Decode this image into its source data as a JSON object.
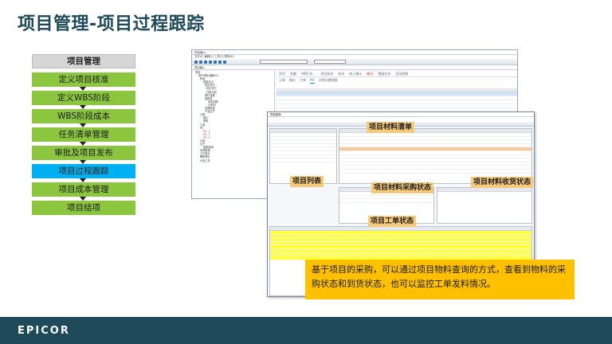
{
  "slide": {
    "title": "项目管理-项目过程跟踪"
  },
  "flow": {
    "header": "项目管理",
    "steps": [
      {
        "label": "定义项目核准",
        "active": false
      },
      {
        "label": "定义WBS阶段",
        "active": false
      },
      {
        "label": "WBS阶段成本",
        "active": false
      },
      {
        "label": "任务清单管理",
        "active": false
      },
      {
        "label": "审批及项目发布",
        "active": false
      },
      {
        "label": "项目过程跟踪",
        "active": true
      },
      {
        "label": "项目成本管理",
        "active": false
      },
      {
        "label": "项目结项",
        "active": false
      }
    ]
  },
  "app": {
    "window_title": "项目输入",
    "menu": "文件(F)  编辑(E)  工具(T)  帮助(H)",
    "nav_bar": "项目输入",
    "tabs": [
      "项目",
      "金额",
      "WBS 阶...",
      "项目成本",
      "成本",
      "收入确认",
      "概况",
      "遗留任务",
      "活动控制"
    ],
    "subtabs": [
      "订单",
      "报价",
      "工单",
      "PO",
      "计划分期明细"
    ],
    "tree": [
      "项目",
      "资产储存设备001",
      "阶段",
      "现金支出",
      "初步支付",
      "初步支付",
      "付款计划",
      "预付金额",
      "装修及",
      "未收到购",
      "已收到",
      "初期资金",
      "产品生产",
      "订单",
      "报价",
      "采购",
      "工单",
      "PO",
      "PO, 1",
      "PO, 1",
      "PO, 1",
      "计划",
      "生产",
      "差旅费用",
      "合同数量",
      "工作量计",
      "概率预计",
      "计划工作"
    ]
  },
  "query": {
    "window_title": "项目查询",
    "labels": {
      "material_list": "项目材料清单",
      "project_list": "项目列表",
      "purchase_status": "项目材料采购状态",
      "receipt_status": "项目材料收货状态",
      "job_status": "项目工单状态"
    }
  },
  "callout": {
    "text": "基于项目的采购，可以通过项目物料查询的方式，查看到物料的采购状态和到货状态，也可以监控工单发料情况。"
  },
  "footer": {
    "logo": "EPICOR"
  }
}
